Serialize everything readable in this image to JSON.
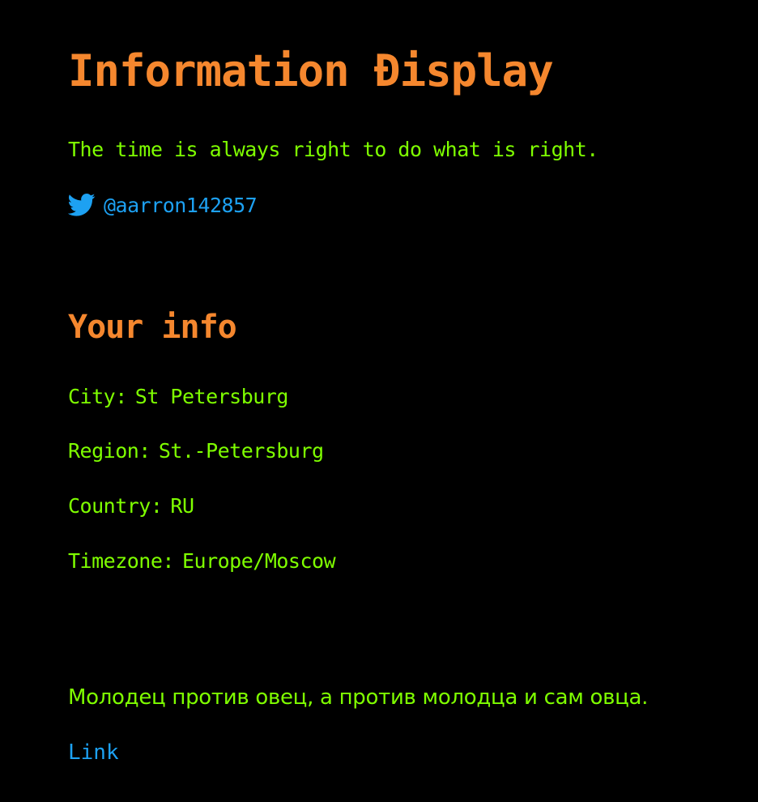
{
  "header": {
    "title": "Information Đisplay",
    "quote": "The time is always right to do what is right.",
    "twitter_handle": "@aarron142857",
    "twitter_icon": "twitter-bird-icon"
  },
  "info": {
    "section_title": "Your info",
    "city_label": "City:",
    "city_value": "St Petersburg",
    "region_label": "Region:",
    "region_value": "St.-Petersburg",
    "country_label": "Country:",
    "country_value": "RU",
    "timezone_label": "Timezone:",
    "timezone_value": "Europe/Moscow"
  },
  "footer": {
    "proverb": "Молодец против овец, а против молодца и сам овца.",
    "link_label": "Link"
  },
  "colors": {
    "background": "#000000",
    "heading": "#f5872e",
    "text": "#7fff00",
    "link": "#1da1f2"
  }
}
